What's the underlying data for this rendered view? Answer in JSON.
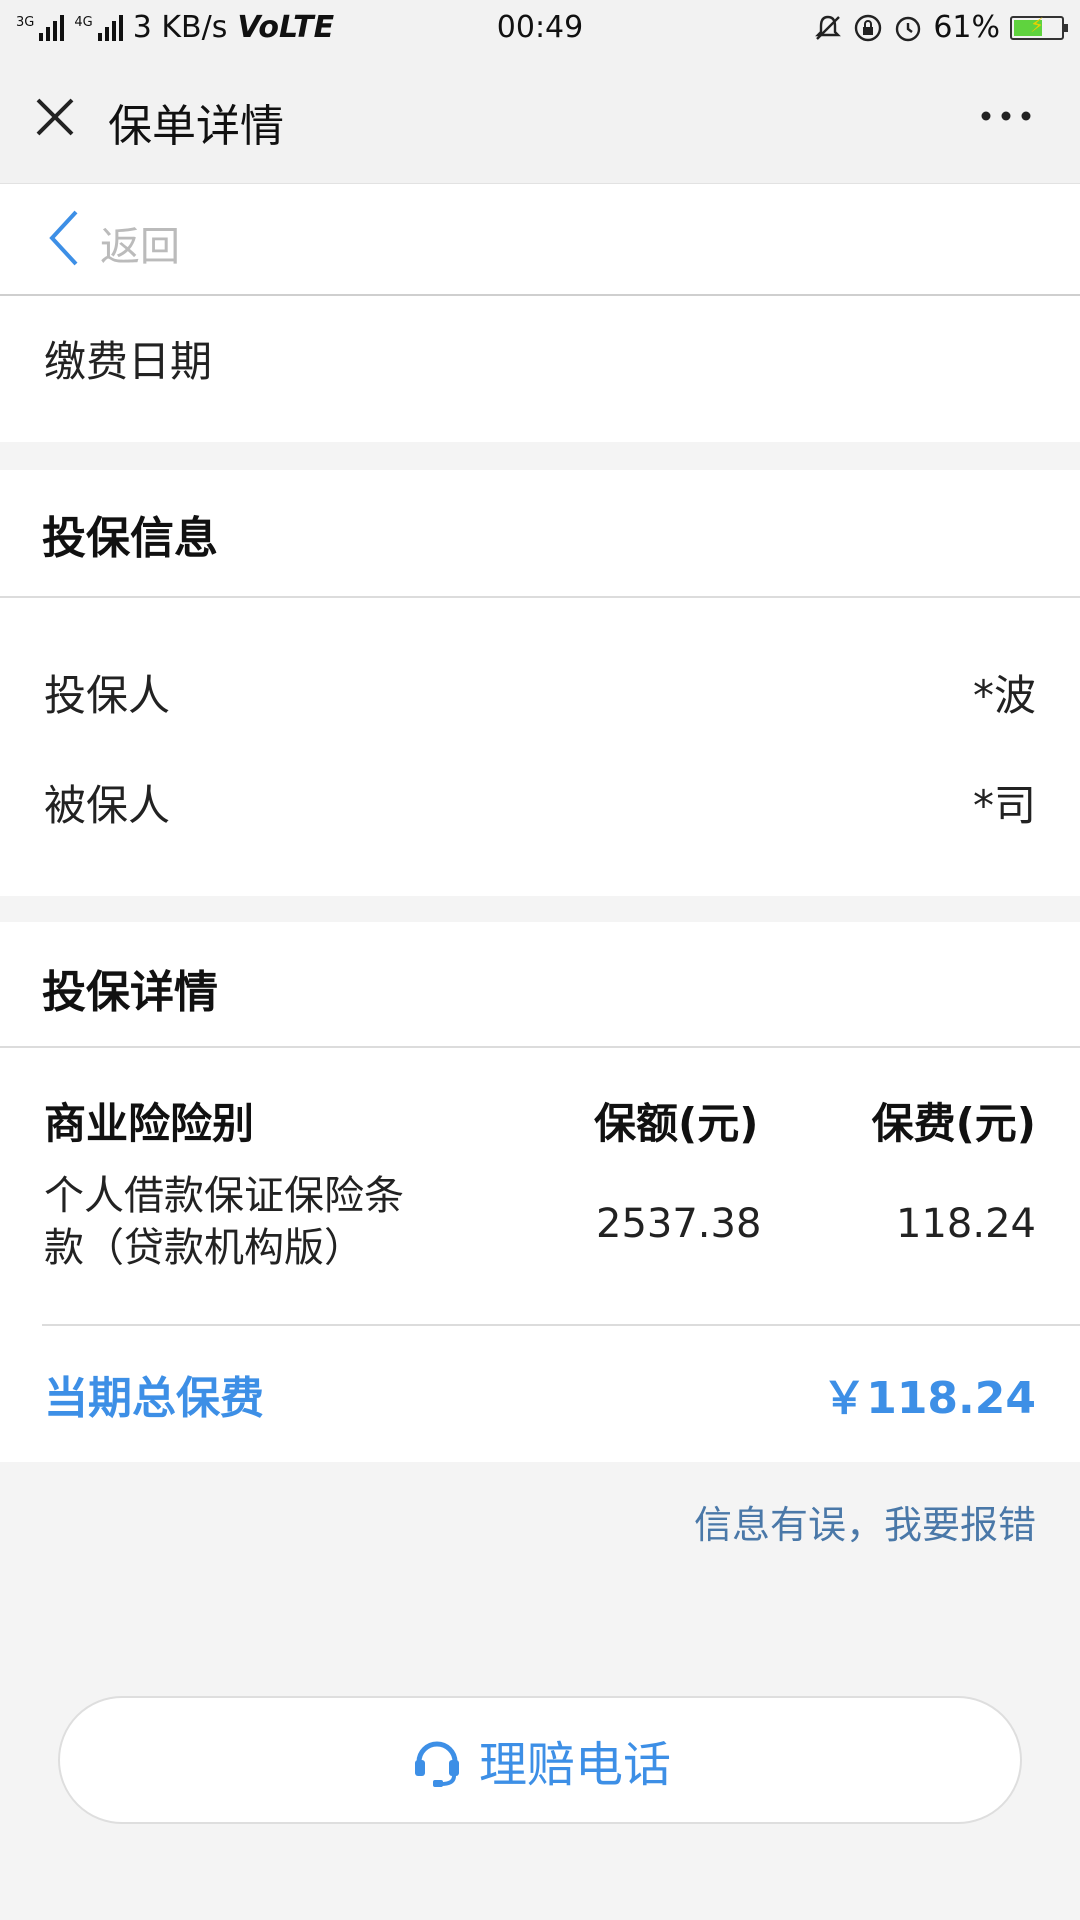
{
  "status_bar": {
    "network_3g": "3G",
    "network_4g": "4G",
    "speed": "3 KB/s",
    "volte": "VoLTE",
    "time": "00:49",
    "battery_percent": "61%",
    "battery_level": 0.61
  },
  "titlebar": {
    "title": "保单详情"
  },
  "backbar": {
    "label": "返回"
  },
  "payment": {
    "date_label": "缴费日期"
  },
  "insured_info": {
    "heading": "投保信息",
    "rows": [
      {
        "label": "投保人",
        "value": "*波"
      },
      {
        "label": "被保人",
        "value": "*司"
      }
    ]
  },
  "policy_details": {
    "heading": "投保详情",
    "columns": [
      "商业险险别",
      "保额(元)",
      "保费(元)"
    ],
    "rows": [
      {
        "type_line1": "个人借款保证保险条",
        "type_line2": "款（贷款机构版）",
        "amount": "2537.38",
        "premium": "118.24"
      }
    ],
    "total_label": "当期总保费",
    "total_value": "￥118.24"
  },
  "report_link": "信息有误，我要报错",
  "claim_button": {
    "label": "理赔电话"
  },
  "colors": {
    "accent": "#3d8fe6",
    "link": "#4a78a8",
    "background": "#f4f4f4"
  },
  "icons": [
    "close-icon",
    "more-icon",
    "back-chevron-icon",
    "headset-icon",
    "mute-icon",
    "lock-rotate-icon",
    "alarm-icon",
    "battery-icon"
  ]
}
